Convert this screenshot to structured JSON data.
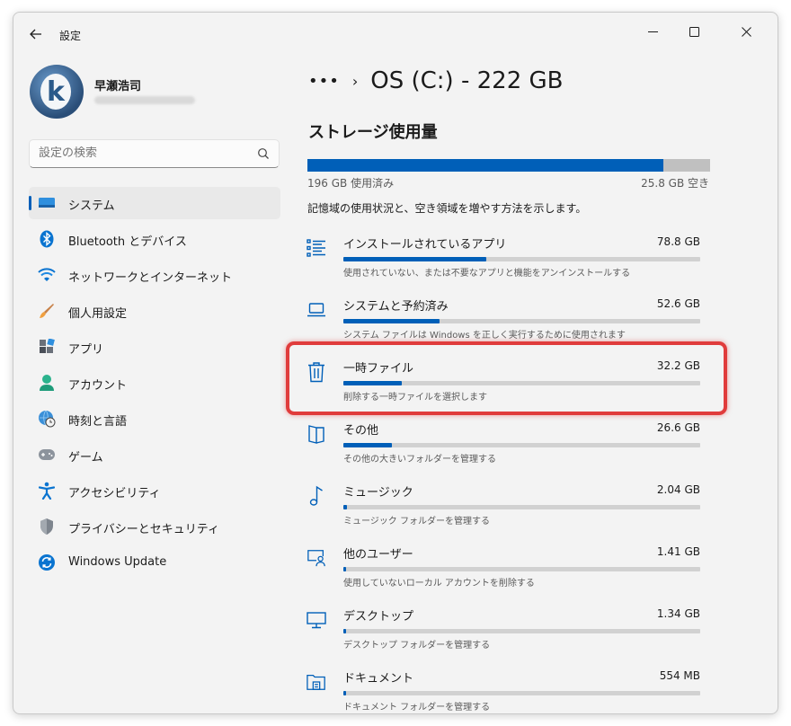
{
  "window": {
    "title": "設定"
  },
  "profile": {
    "name": "早瀬浩司"
  },
  "search": {
    "placeholder": "設定の検索"
  },
  "nav": {
    "items": [
      {
        "label": "システム",
        "icon": "system-icon",
        "selected": true
      },
      {
        "label": "Bluetooth とデバイス",
        "icon": "bluetooth-icon"
      },
      {
        "label": "ネットワークとインターネット",
        "icon": "wifi-icon"
      },
      {
        "label": "個人用設定",
        "icon": "brush-icon"
      },
      {
        "label": "アプリ",
        "icon": "apps-icon"
      },
      {
        "label": "アカウント",
        "icon": "account-icon"
      },
      {
        "label": "時刻と言語",
        "icon": "globe-clock-icon"
      },
      {
        "label": "ゲーム",
        "icon": "gamepad-icon"
      },
      {
        "label": "アクセシビリティ",
        "icon": "accessibility-icon"
      },
      {
        "label": "プライバシーとセキュリティ",
        "icon": "shield-icon"
      },
      {
        "label": "Windows Update",
        "icon": "update-icon"
      }
    ]
  },
  "breadcrumb": {
    "more": "•••",
    "separator": "›",
    "title": "OS (C:) - 222 GB"
  },
  "storage": {
    "section_title": "ストレージ使用量",
    "used_label": "196 GB 使用済み",
    "free_label": "25.8 GB 空き",
    "used_fraction": 0.884,
    "description": "記憶域の使用状況と、空き領域を増やす方法を示します。"
  },
  "categories": [
    {
      "name": "インストールされているアプリ",
      "size": "78.8 GB",
      "sub": "使用されていない、または不要なアプリと機能をアンインストールする",
      "fraction": 0.4,
      "icon": "apps-list-icon"
    },
    {
      "name": "システムと予約済み",
      "size": "52.6 GB",
      "sub": "システム ファイルは Windows を正しく実行するために使用されます",
      "fraction": 0.27,
      "icon": "laptop-icon"
    },
    {
      "name": "一時ファイル",
      "size": "32.2 GB",
      "sub": "削除する一時ファイルを選択します",
      "fraction": 0.164,
      "icon": "trash-icon",
      "highlighted": true
    },
    {
      "name": "その他",
      "size": "26.6 GB",
      "sub": "その他の大きいフォルダーを管理する",
      "fraction": 0.136,
      "icon": "folder-icon"
    },
    {
      "name": "ミュージック",
      "size": "2.04 GB",
      "sub": "ミュージック フォルダーを管理する",
      "fraction": 0.01,
      "icon": "music-icon"
    },
    {
      "name": "他のユーザー",
      "size": "1.41 GB",
      "sub": "使用していないローカル アカウントを削除する",
      "fraction": 0.007,
      "icon": "user-monitor-icon"
    },
    {
      "name": "デスクトップ",
      "size": "1.34 GB",
      "sub": "デスクトップ フォルダーを管理する",
      "fraction": 0.007,
      "icon": "desktop-icon"
    },
    {
      "name": "ドキュメント",
      "size": "554 MB",
      "sub": "ドキュメント フォルダーを管理する",
      "fraction": 0.003,
      "icon": "documents-folder-icon"
    }
  ],
  "colors": {
    "accent": "#005fb8",
    "highlight": "#e03c3c"
  }
}
